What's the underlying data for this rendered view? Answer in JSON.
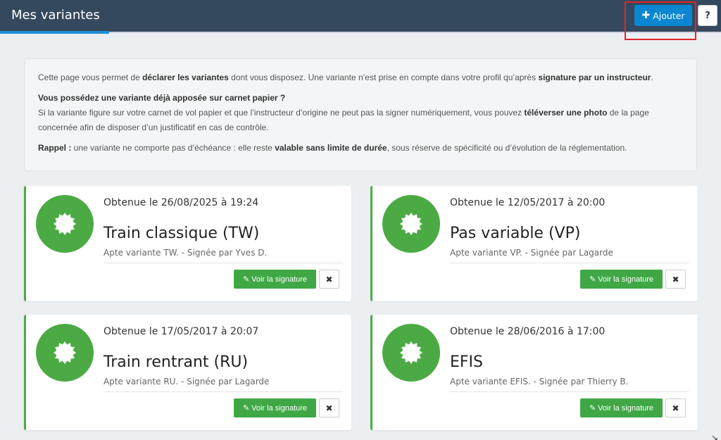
{
  "header": {
    "title": "Mes variantes",
    "add_label": "Ajouter",
    "help_label": "?"
  },
  "info": {
    "p1_a": "Cette page vous permet de ",
    "p1_b": "déclarer les variantes",
    "p1_c": " dont vous disposez. Une variante n’est prise en compte dans votre profil qu’après ",
    "p1_d": "signature par un instructeur",
    "p1_e": ".",
    "p2_title": "Vous possédez une variante déjà apposée sur carnet papier ?",
    "p2_a": "Si la variante figure sur votre carnet de vol papier et que l’instructeur d’origine ne peut pas la signer numériquement, vous pouvez ",
    "p2_b": "téléverser une photo",
    "p2_c": " de la page concernée afin de disposer d’un justificatif en cas de contrôle.",
    "p3_a": "Rappel :",
    "p3_b": " une variante ne comporte pas d’échéance : elle reste ",
    "p3_c": "valable sans limite de durée",
    "p3_d": ", sous réserve de spécificité ou d’évolution de la réglementation."
  },
  "cards": [
    {
      "date": "Obtenue le 26/08/2025 à 19:24",
      "name": "Train classique (TW)",
      "sub": "Apte variante TW. - Signée par Yves D.",
      "sig_label": "Voir la signature",
      "close": "✖"
    },
    {
      "date": "Obtenue le 12/05/2017 à 20:00",
      "name": "Pas variable (VP)",
      "sub": "Apte variante VP. - Signée par Lagarde",
      "sig_label": "Voir la signature",
      "close": "✖"
    },
    {
      "date": "Obtenue le 17/05/2017 à 20:07",
      "name": "Train rentrant (RU)",
      "sub": "Apte variante RU. - Signée par Lagarde",
      "sig_label": "Voir la signature",
      "close": "✖"
    },
    {
      "date": "Obtenue le 28/06/2016 à 17:00",
      "name": "EFIS",
      "sub": "Apte variante EFIS. - Signée par Thierry B.",
      "sig_label": "Voir la signature",
      "close": "✖"
    }
  ],
  "colors": {
    "header_bg": "#34495e",
    "accent_blue": "#0b86d1",
    "success_green": "#4caa45"
  },
  "icons": {
    "add": "plus-icon",
    "badge": "seal-icon",
    "signature": "edit-icon",
    "delete": "close-icon"
  }
}
